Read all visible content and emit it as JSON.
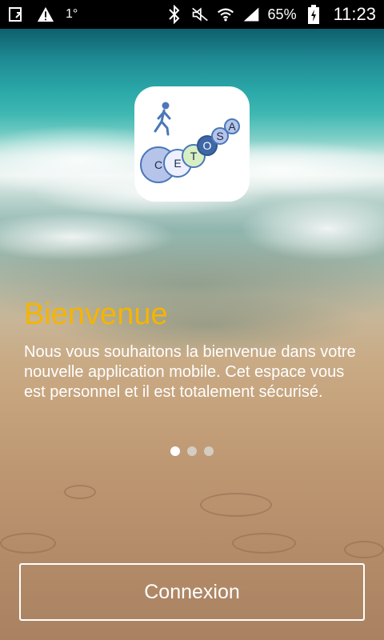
{
  "status_bar": {
    "temperature": "1°",
    "battery_percent": "65%",
    "time": "11:23",
    "icons": [
      "screen-cast-icon",
      "warning-icon",
      "bluetooth-icon",
      "mute-icon",
      "wifi-icon",
      "signal-icon",
      "battery-charging-icon"
    ]
  },
  "logo": {
    "letters": [
      "C",
      "E",
      "T",
      "O",
      "S",
      "A"
    ],
    "colors": {
      "blue": "#4a78b8",
      "lavender": "#b7c4ea",
      "light_green": "#d8efc3",
      "navy": "#3f67a6"
    }
  },
  "welcome": {
    "title": "Bienvenue",
    "body": "Nous vous souhaitons la bienvenue dans votre nouvelle application mobile. Cet espace vous est personnel et il est totalement sécurisé."
  },
  "pager": {
    "total": 3,
    "active_index": 0
  },
  "actions": {
    "login_label": "Connexion"
  },
  "colors": {
    "title": "#f6b400",
    "text": "#ffffff"
  }
}
